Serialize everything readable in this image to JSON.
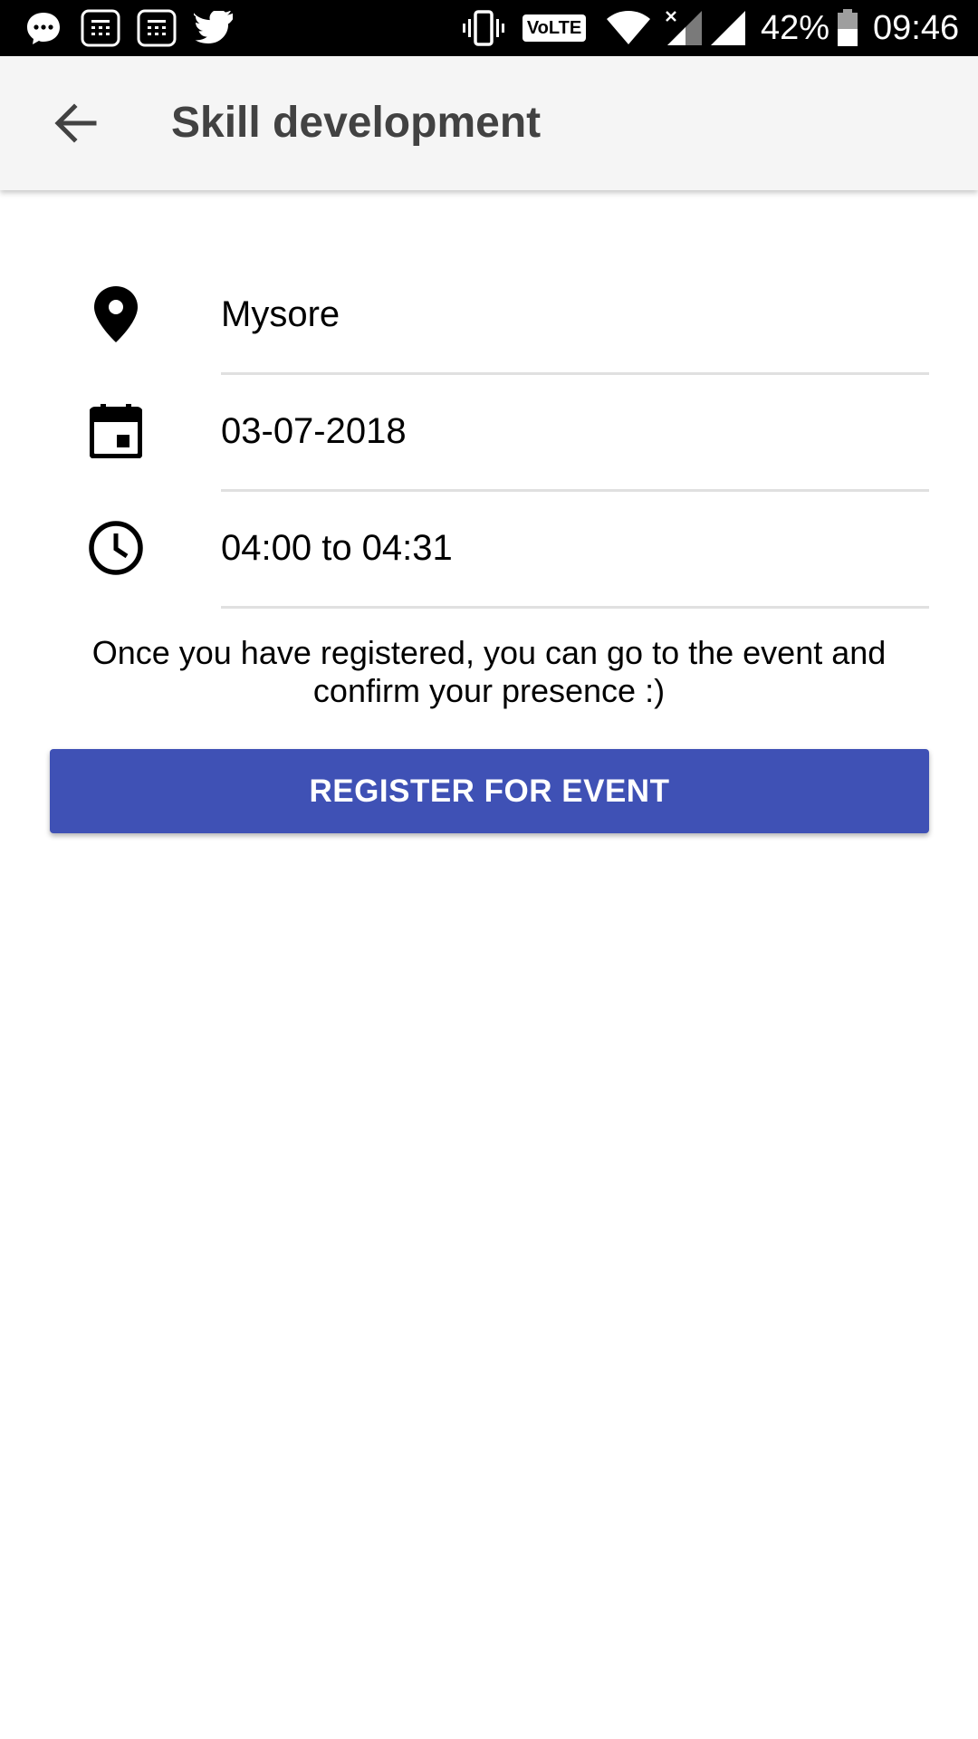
{
  "status_bar": {
    "notification_icons": [
      "messenger-icon",
      "sms-icon",
      "sms-icon",
      "twitter-icon"
    ],
    "system_icons": [
      "vibrate-icon",
      "volte-icon",
      "wifi-icon",
      "signal-no-service-icon",
      "signal-icon",
      "battery-icon"
    ],
    "volte_label": "VoLTE",
    "battery_percent": "42%",
    "time": "09:46"
  },
  "toolbar": {
    "back_icon": "arrow-back-icon",
    "title": "Skill development",
    "background": "#f5f5f5"
  },
  "event": {
    "location": {
      "icon": "location-pin-icon",
      "value": "Mysore"
    },
    "date": {
      "icon": "calendar-icon",
      "value": "03-07-2018"
    },
    "time": {
      "icon": "clock-icon",
      "value": "04:00 to 04:31"
    }
  },
  "info_text": "Once you have registered, you can go to the event and confirm your presence :)",
  "register_button": {
    "label": "REGISTER FOR EVENT",
    "color": "#3f51b5"
  }
}
